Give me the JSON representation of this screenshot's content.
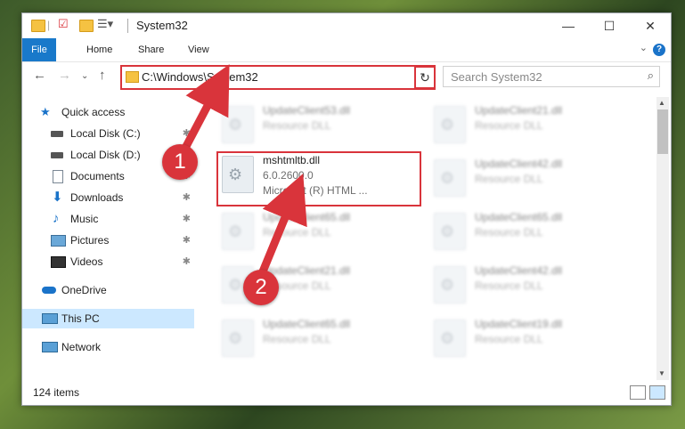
{
  "window": {
    "title": "System32",
    "controls": {
      "minimize": "—",
      "maximize": "☐",
      "close": "✕"
    }
  },
  "ribbon": {
    "tabs": [
      "File",
      "Home",
      "Share",
      "View"
    ],
    "help": "?"
  },
  "address": {
    "path": "C:\\Windows\\System32",
    "search_placeholder": "Search System32"
  },
  "nav": {
    "items": [
      {
        "label": "Quick access",
        "icon": "star-icon"
      },
      {
        "label": "Local Disk (C:)",
        "icon": "drive-icon"
      },
      {
        "label": "Local Disk (D:)",
        "icon": "drive-icon"
      },
      {
        "label": "Documents",
        "icon": "documents-icon"
      },
      {
        "label": "Downloads",
        "icon": "download-icon"
      },
      {
        "label": "Music",
        "icon": "music-icon"
      },
      {
        "label": "Pictures",
        "icon": "pictures-icon"
      },
      {
        "label": "Videos",
        "icon": "videos-icon"
      },
      {
        "label": "OneDrive",
        "icon": "cloud-icon"
      },
      {
        "label": "This PC",
        "icon": "computer-icon"
      },
      {
        "label": "Network",
        "icon": "network-icon"
      }
    ]
  },
  "files": {
    "highlighted": {
      "name": "mshtmltb.dll",
      "version": "6.0.2600.0",
      "desc": "Microsoft (R) HTML ..."
    },
    "blurred": [
      {
        "name": "UpdateClient53.dll",
        "desc": "Resource DLL"
      },
      {
        "name": "UpdateClient21.dll",
        "desc": "Resource DLL"
      },
      {
        "name": "UpdateClient42.dll",
        "desc": "Resource DLL"
      },
      {
        "name": "UpdateClient65.dll",
        "desc": "Resource DLL"
      },
      {
        "name": "UpdateClient65.dll",
        "desc": "Resource DLL"
      },
      {
        "name": "UpdateClient21.dll",
        "desc": "Resource DLL"
      },
      {
        "name": "UpdateClient42.dll",
        "desc": "Resource DLL"
      },
      {
        "name": "UpdateClient65.dll",
        "desc": "Resource DLL"
      },
      {
        "name": "UpdateClient19.dll",
        "desc": "Resource DLL"
      }
    ]
  },
  "status": {
    "count": "124 items"
  },
  "annotations": {
    "step1": "1",
    "step2": "2",
    "color": "#d9343b"
  }
}
